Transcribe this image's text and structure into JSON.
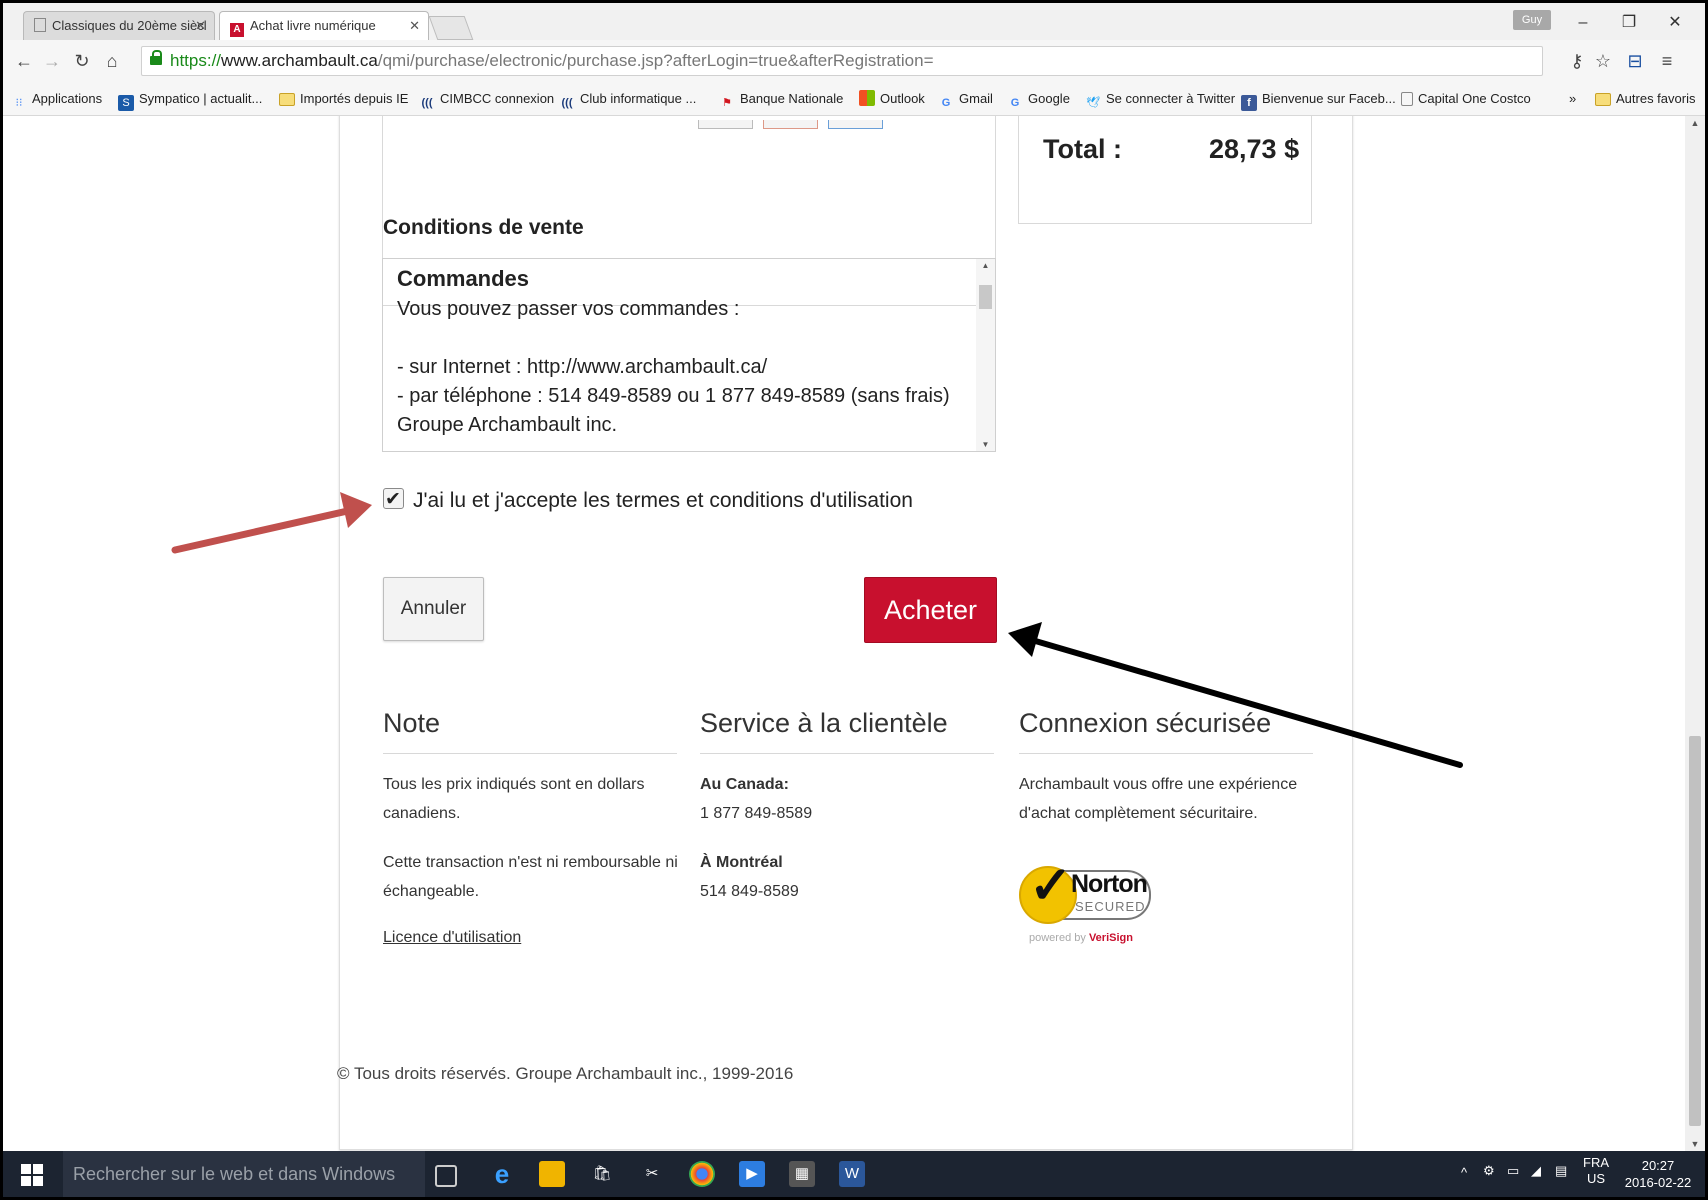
{
  "browser": {
    "tabs": [
      {
        "label": "Classiques du 20ème siècl",
        "active": false
      },
      {
        "label": "Achat livre numérique",
        "active": true
      }
    ],
    "user": "Guy",
    "url": {
      "scheme": "https://",
      "host": "www.archambault.ca",
      "path": "/qmi/purchase/electronic/purchase.jsp?afterLogin=true&afterRegistration="
    },
    "bookmarks": [
      "Applications",
      "Sympatico | actualit...",
      "Importés depuis IE",
      "CIMBCC connexion",
      "Club informatique ...",
      "Banque Nationale",
      "Outlook",
      "Gmail",
      "Google",
      "Se connecter à Twitter",
      "Bienvenue sur Faceb...",
      "Capital One Costco"
    ],
    "bookmarks_more": "»",
    "other_bookmarks": "Autres favoris"
  },
  "order": {
    "total_label": "Total :",
    "total_value": "28,73 $"
  },
  "conditions": {
    "title": "Conditions de vente",
    "heading": "Commandes",
    "lines": [
      "Vous pouvez passer vos commandes :",
      "",
      "- sur Internet : http://www.archambault.ca/",
      "- par téléphone : 514 849-8589 ou 1 877 849-8589 (sans frais)",
      "Groupe Archambault inc."
    ]
  },
  "accept": {
    "label": "J'ai lu et j'accepte les termes et conditions d'utilisation",
    "checked": true
  },
  "buttons": {
    "cancel": "Annuler",
    "buy": "Acheter"
  },
  "footer": {
    "note": {
      "title": "Note",
      "lines": [
        "Tous les prix indiqués sont en dollars",
        "canadiens.",
        "Cette transaction n'est ni remboursable ni",
        "échangeable."
      ],
      "license": "Licence d'utilisation"
    },
    "service": {
      "title": "Service à la clientèle",
      "canada_label": "Au Canada:",
      "canada_phone": "1 877 849-8589",
      "montreal_label": "À Montréal",
      "montreal_phone": "514 849-8589"
    },
    "secure": {
      "title": "Connexion sécurisée",
      "lines": [
        "Archambault vous offre une expérience",
        "d'achat complètement sécuritaire."
      ],
      "badge_word": "Norton",
      "badge_secured": "SECURED",
      "badge_powered": "powered by",
      "badge_verisign": "VeriSign"
    },
    "copyright": "© Tous droits réservés. Groupe Archambault inc., 1999-2016"
  },
  "taskbar": {
    "search_placeholder": "Rechercher sur le web et dans Windows",
    "lang_top": "FRA",
    "lang_bottom": "US",
    "time": "20:27",
    "date": "2016-02-22"
  },
  "colors": {
    "buy_button": "#c8102e",
    "annotation_red": "#c0504d",
    "annotation_black": "#000000"
  }
}
